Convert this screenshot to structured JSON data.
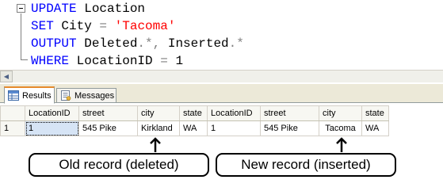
{
  "editor": {
    "line1": {
      "keyword": "UPDATE",
      "rest": " Location"
    },
    "line2": {
      "keyword": "SET",
      "rest": " City ",
      "op": "=",
      "string": "'Tacoma'"
    },
    "line3": {
      "keyword": "OUTPUT",
      "rest": " Deleted",
      "op1": ".*,",
      "rest2": " Inserted",
      "op2": ".*"
    },
    "line4": {
      "keyword": "WHERE",
      "rest": " LocationID ",
      "op": "=",
      "rest2": " 1"
    }
  },
  "tabs": {
    "results_label": "Results",
    "messages_label": "Messages"
  },
  "grid": {
    "columns": [
      "LocationID",
      "street",
      "city",
      "state",
      "LocationID",
      "street",
      "city",
      "state"
    ],
    "rows": [
      {
        "num": "1",
        "cells": [
          "1",
          "545 Pike",
          "Kirkland",
          "WA",
          "1",
          "545 Pike",
          "Tacoma",
          "WA"
        ]
      }
    ]
  },
  "annotations": {
    "old_label": "Old record (deleted)",
    "new_label": "New record (inserted)"
  },
  "colors": {
    "keyword": "#0000ff",
    "string": "#ff0000",
    "operator": "#808080",
    "active_tab_accent": "#e68b2c"
  },
  "icons": [
    "collapse-minus-icon",
    "scroll-left-arrow-icon",
    "results-grid-icon",
    "messages-icon",
    "up-arrow-icon"
  ]
}
